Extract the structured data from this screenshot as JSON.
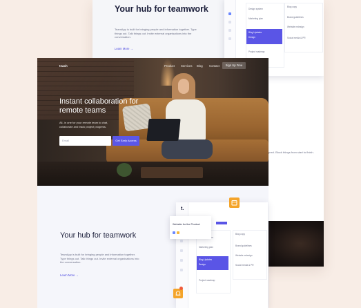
{
  "back_section": {
    "title": "Your hub for teamwork",
    "body": "TeamApp is built for bringing people and information together. Type things out. Talk things out. Invite external organisations into the conversation.",
    "learn_more": "Learn More →",
    "side_text": "aligned. Block things from start to finish.",
    "app": {
      "col1_items": [
        "Design system",
        "Marketing plan",
        "Design",
        "Blog Updates",
        "Project roadmap"
      ],
      "col1_card": "Blog Updates",
      "col2_header": "Blog copy",
      "col2_items": [
        "Brand guidelines",
        "Website redesign",
        "Social media & PR"
      ]
    }
  },
  "hero": {
    "logo": "teach",
    "nav": [
      "Product",
      "Services",
      "Blog",
      "Contact"
    ],
    "signup": "Sign Up Free",
    "title": "Instant collaboration for remote teams",
    "subtitle": "All- in one for your remote team to chat, collaborate and track project progress.",
    "email_placeholder": "Email",
    "cta": "Get Early Access"
  },
  "lower_section": {
    "title": "Your hub for teamwork",
    "body": "TeamApp is built for bringing people and information together. Type things out. Talk things out. Invite external organisations into the conversation.",
    "learn_more": "Learn More →",
    "app": {
      "logo": "t.",
      "popup_title": "Website for the Product",
      "col1_items": [
        "Design system",
        "Marketing plan",
        "Design",
        "Blog Updates",
        "Project roadmap"
      ],
      "col1_card": "Blog Updates",
      "col2_header": "Blog copy",
      "col2_items": [
        "Brand guidelines",
        "Website redesign",
        "Social media & PR"
      ]
    }
  },
  "colors": {
    "accent": "#5b57e8",
    "badge": "#f4a42a",
    "background": "#f8ede6"
  },
  "icons": [
    "calendar-icon",
    "bell-icon"
  ]
}
